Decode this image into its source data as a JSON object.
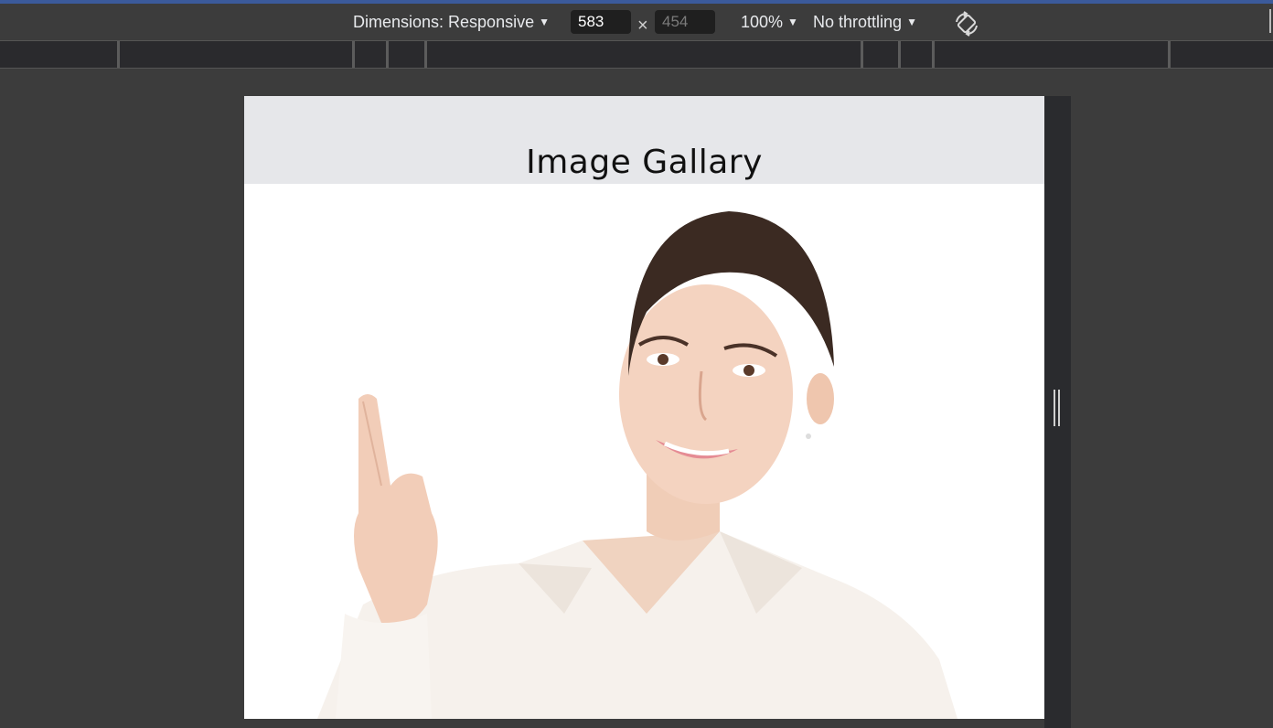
{
  "devtools": {
    "dimensions_label": "Dimensions: Responsive",
    "width_value": "583",
    "height_placeholder": "454",
    "times_symbol": "×",
    "zoom_label": "100%",
    "throttling_label": "No throttling",
    "icons": {
      "caret": "caret-down-icon",
      "rotate": "rotate-icon"
    },
    "colors": {
      "accent_line": "#3b5a9b",
      "toolbar_bg": "#3c3c3c"
    }
  },
  "page": {
    "header": {
      "title": "Image Gallary",
      "background": "#e6e7ea"
    },
    "image": {
      "alt": "woman-pointing-up-photo"
    }
  }
}
